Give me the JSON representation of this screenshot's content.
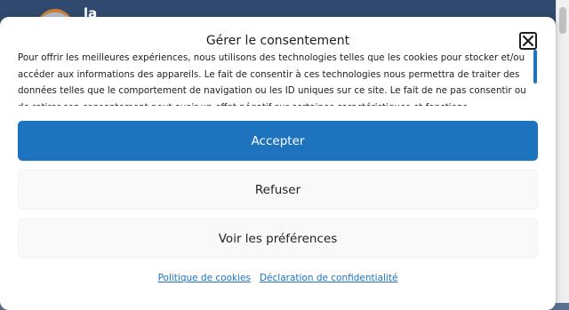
{
  "background": {
    "logo_text": "la"
  },
  "consent": {
    "title": "Gérer le consentement",
    "close_icon": "close-icon",
    "message": "Pour offrir les meilleures expériences, nous utilisons des technologies telles que les cookies pour stocker et/ou accéder aux informations des appareils. Le fait de consentir à ces technologies nous permettra de traiter des données telles que le comportement de navigation ou les ID uniques sur ce site. Le fait de ne pas consentir ou de retirer son consentement peut avoir un effet négatif sur certaines caractéristiques et fonctions.",
    "accept_label": "Accepter",
    "deny_label": "Refuser",
    "preferences_label": "Voir les préférences",
    "links": [
      {
        "label": "Politique de cookies"
      },
      {
        "label": "Déclaration de confidentialité"
      }
    ]
  },
  "colors": {
    "accent": "#1e73be",
    "header_bg": "#2f4a6e"
  }
}
